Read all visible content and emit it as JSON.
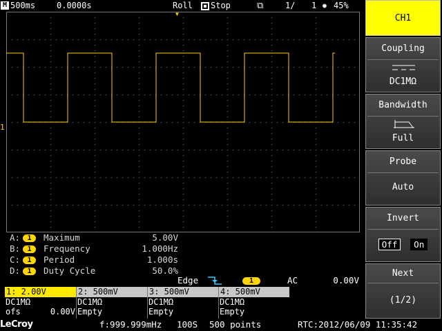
{
  "topbar": {
    "mode_icon": "M",
    "timebase": "500ms",
    "delay": "0.0000s",
    "acquisition_mode": "Roll",
    "status": "Stop",
    "page": "1/",
    "count": "1",
    "brightness": "45%",
    "icons": [
      "stop-square-icon",
      "layers-icon",
      "brightness-sun-icon"
    ]
  },
  "channel1_marker": "1",
  "trigger_position_marker": "▼",
  "measurements": [
    {
      "key": "A:",
      "channel": "1",
      "name": "Maximum",
      "value": "5.00V"
    },
    {
      "key": "B:",
      "channel": "1",
      "name": "Frequency",
      "value": "1.000Hz"
    },
    {
      "key": "C:",
      "channel": "1",
      "name": "Period",
      "value": "1.000s"
    },
    {
      "key": "D:",
      "channel": "1",
      "name": "Duty Cycle",
      "value": "50.0%"
    }
  ],
  "trigger": {
    "type": "Edge",
    "source": "1",
    "coupling": "AC",
    "level": "0.00V"
  },
  "channels": [
    {
      "header": "1: 2.00V",
      "coupling": "DC1MΩ",
      "line3_left": "ofs",
      "line3_right": "0.00V"
    },
    {
      "header": "2: 500mV",
      "coupling": "DC1MΩ",
      "line3_left": "Empty",
      "line3_right": ""
    },
    {
      "header": "3: 500mV",
      "coupling": "DC1MΩ",
      "line3_left": "Empty",
      "line3_right": ""
    },
    {
      "header": "4: 500mV",
      "coupling": "DC1MΩ",
      "line3_left": "Empty",
      "line3_right": ""
    }
  ],
  "bottombar": {
    "logo": "LeCroy",
    "frequency": "f:999.999mHz",
    "sample_rate": "100S",
    "points": "500 points",
    "rtc": "RTC:2012/06/09 11:35:42"
  },
  "menu": {
    "title": "CH1",
    "coupling": {
      "label": "Coupling",
      "value": "DC1MΩ",
      "icon": "dc-coupling-icon"
    },
    "bandwidth": {
      "label": "Bandwidth",
      "value": "Full",
      "icon": "bandwidth-icon"
    },
    "probe": {
      "label": "Probe",
      "value": "Auto"
    },
    "invert": {
      "label": "Invert",
      "off": "Off",
      "on": "On"
    },
    "next": {
      "label": "Next",
      "value": "(1/2)"
    }
  },
  "colors": {
    "ch1": "#ffd400",
    "menu_title_bg": "#ffff00",
    "grid": "#7a7a7a"
  },
  "waveform": {
    "shape": "square",
    "period_s": 1.0,
    "duty_cycle": 0.5,
    "high_v": 5.0,
    "low_v": 0.0,
    "volts_per_div": 2.0,
    "seconds_per_div": 0.5
  }
}
